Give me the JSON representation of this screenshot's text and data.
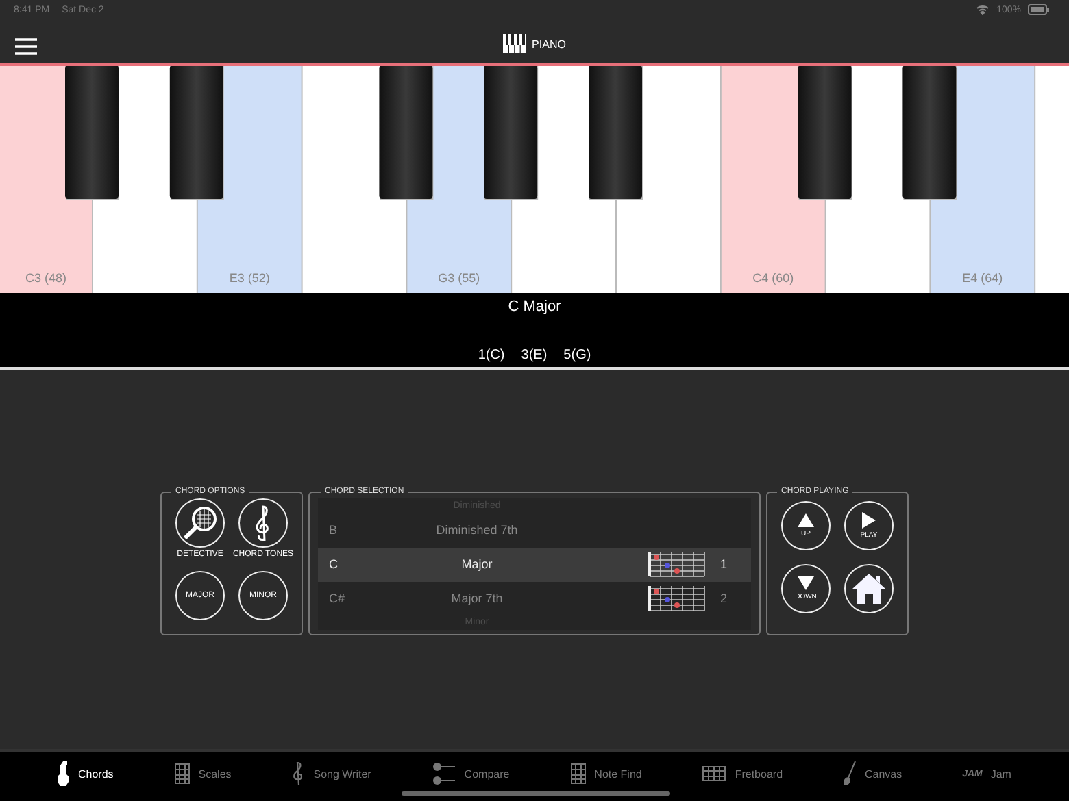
{
  "status_bar": {
    "time": "8:41 PM",
    "date": "Sat Dec 2",
    "battery": "100%"
  },
  "header": {
    "title": "PIANO"
  },
  "keyboard": {
    "white_keys": [
      {
        "label": "C3 (48)",
        "color": "#fcd2d4",
        "sharp": true
      },
      {
        "color": "#ffffff",
        "sharp": true
      },
      {
        "label": "E3 (52)",
        "color": "#cfdff8",
        "sharp": false
      },
      {
        "color": "#ffffff",
        "sharp": true
      },
      {
        "label": "G3 (55)",
        "color": "#cfdff8",
        "sharp": true
      },
      {
        "color": "#ffffff",
        "sharp": true
      },
      {
        "color": "#ffffff",
        "sharp": false
      },
      {
        "label": "C4 (60)",
        "color": "#fcd2d4",
        "sharp": true
      },
      {
        "color": "#ffffff",
        "sharp": true
      },
      {
        "label": "E4 (64)",
        "color": "#cfdff8",
        "sharp": false
      },
      {
        "color": "#ffffff",
        "sharp": false
      }
    ]
  },
  "chord_info": {
    "name": "C Major",
    "tones": [
      "1(C)",
      "3(E)",
      "5(G)"
    ]
  },
  "chord_options": {
    "title": "CHORD OPTIONS",
    "buttons": [
      {
        "kind": "detective",
        "label": "DETECTIVE"
      },
      {
        "kind": "clef",
        "label": "CHORD TONES"
      },
      {
        "kind": "text",
        "label": "MAJOR"
      },
      {
        "kind": "text",
        "label": "MINOR"
      }
    ]
  },
  "chord_selection": {
    "title": "CHORD SELECTION",
    "rows": [
      {
        "quality": "Diminished",
        "selected": false,
        "faded": true
      },
      {
        "root": "B",
        "quality": "Diminished 7th",
        "number": "",
        "selected": false,
        "faded": false
      },
      {
        "root": "C",
        "quality": "Major",
        "number": "1",
        "selected": true,
        "faded": false
      },
      {
        "root": "C#",
        "quality": "Major 7th",
        "number": "2",
        "selected": false,
        "faded": false
      },
      {
        "quality": "Minor",
        "selected": false,
        "faded": true
      }
    ]
  },
  "chord_playing": {
    "title": "CHORD PLAYING",
    "buttons": [
      {
        "kind": "up",
        "label": "UP"
      },
      {
        "kind": "play",
        "label": "PLAY"
      },
      {
        "kind": "down",
        "label": "DOWN"
      },
      {
        "kind": "home"
      }
    ]
  },
  "tab_bar": [
    {
      "label": "Chords",
      "kind": "guitar",
      "selected": true
    },
    {
      "label": "Scales",
      "kind": "grid",
      "selected": false
    },
    {
      "label": "Song Writer",
      "kind": "clef",
      "selected": false
    },
    {
      "label": "Compare",
      "kind": "compare",
      "selected": false
    },
    {
      "label": "Note Find",
      "kind": "grid",
      "selected": false
    },
    {
      "label": "Fretboard",
      "kind": "fret",
      "selected": false
    },
    {
      "label": "Canvas",
      "kind": "brush",
      "selected": false
    },
    {
      "label": "Jam",
      "kind": "jam",
      "logo": "JAM",
      "selected": false
    }
  ]
}
